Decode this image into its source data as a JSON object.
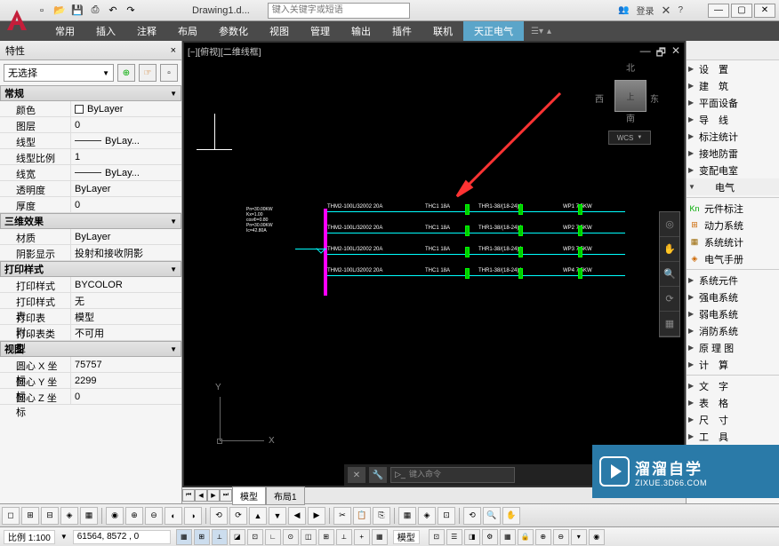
{
  "doc_title": "Drawing1.d...",
  "search_placeholder": "键入关键字或短语",
  "login_label": "登录",
  "ribbon_tabs": [
    "常用",
    "插入",
    "注释",
    "布局",
    "参数化",
    "视图",
    "管理",
    "输出",
    "插件",
    "联机",
    "天正电气"
  ],
  "ribbon_active_idx": 10,
  "props": {
    "panel_title": "特性",
    "no_select": "无选择",
    "groups": {
      "general": {
        "header": "常规",
        "items": [
          {
            "label": "颜色",
            "val": "ByLayer",
            "sw": true
          },
          {
            "label": "图层",
            "val": "0"
          },
          {
            "label": "线型",
            "val": "ByLay...",
            "line": true
          },
          {
            "label": "线型比例",
            "val": "1"
          },
          {
            "label": "线宽",
            "val": "ByLay...",
            "line": true
          },
          {
            "label": "透明度",
            "val": "ByLayer"
          },
          {
            "label": "厚度",
            "val": "0"
          }
        ]
      },
      "fx": {
        "header": "三维效果",
        "items": [
          {
            "label": "材质",
            "val": "ByLayer"
          },
          {
            "label": "阴影显示",
            "val": "投射和接收阴影"
          }
        ]
      },
      "plot": {
        "header": "打印样式",
        "items": [
          {
            "label": "打印样式",
            "val": "BYCOLOR"
          },
          {
            "label": "打印样式表",
            "val": "无"
          },
          {
            "label": "打印表附...",
            "val": "模型"
          },
          {
            "label": "打印表类型",
            "val": "不可用"
          }
        ]
      },
      "view": {
        "header": "视图",
        "items": [
          {
            "label": "圆心 X 坐标",
            "val": "75757"
          },
          {
            "label": "圆心 Y 坐标",
            "val": "2299"
          },
          {
            "label": "圆心 Z 坐标",
            "val": "0"
          }
        ]
      }
    }
  },
  "canvas": {
    "label": "[−][俯视][二维线框]",
    "viewcube": {
      "n": "北",
      "s": "南",
      "w": "西",
      "e": "东",
      "top": "上",
      "wcs": "WCS"
    },
    "info_lines": [
      "Pn=30.00KW",
      "Kx=1.00",
      "cosΦ=0.80",
      "Pn=30.00KW",
      "Ic=42.80A"
    ],
    "branches": [
      {
        "thm": "THM2-100L/32002 20A",
        "thc": "THC1 18A",
        "thr": "THR1-38/(18-24)A",
        "wp": "WP1 7.5KW"
      },
      {
        "thm": "THM2-100L/32002 20A",
        "thc": "THC1 18A",
        "thr": "THR1-38/(18-24)A",
        "wp": "WP2 7.5KW"
      },
      {
        "thm": "THM2-100L/32002 20A",
        "thc": "THC1 18A",
        "thr": "THR1-38/(18-24)A",
        "wp": "WP3 7.5KW"
      },
      {
        "thm": "THM2-100L/32002 20A",
        "thc": "THC1 18A",
        "thr": "THR1-38/(18-24)A",
        "wp": "WP4 7.5KW"
      }
    ],
    "axis": {
      "x": "X",
      "y": "Y"
    },
    "cmd_placeholder": "键入命令",
    "tabs": {
      "model": "模型",
      "layout": "布局1"
    }
  },
  "right_panel": {
    "items1": [
      {
        "label": "设　置"
      },
      {
        "label": "建　筑"
      },
      {
        "label": "平面设备"
      },
      {
        "label": "导　线"
      },
      {
        "label": "标注统计"
      },
      {
        "label": "接地防雷"
      },
      {
        "label": "变配电室"
      }
    ],
    "elec_header": "电气",
    "items2": [
      {
        "label": "元件标注",
        "ico": "Kn",
        "col": "#0a0"
      },
      {
        "label": "动力系统",
        "ico": "⊞",
        "col": "#c60"
      },
      {
        "label": "系统统计",
        "ico": "▦",
        "col": "#960"
      },
      {
        "label": "电气手册",
        "ico": "◈",
        "col": "#c60"
      }
    ],
    "items3": [
      {
        "label": "系统元件"
      },
      {
        "label": "强电系统"
      },
      {
        "label": "弱电系统"
      },
      {
        "label": "消防系统"
      },
      {
        "label": "原 理 图"
      },
      {
        "label": "计　算"
      }
    ],
    "items4": [
      {
        "label": "文　字"
      },
      {
        "label": "表　格"
      },
      {
        "label": "尺　寸"
      },
      {
        "label": "工　具"
      }
    ]
  },
  "status": {
    "scale_label": "比例 1:100",
    "coords": "61564, 8572 , 0",
    "model_label": "模型"
  },
  "watermark": {
    "cn": "溜溜自学",
    "url": "ZIXUE.3D66.COM"
  }
}
